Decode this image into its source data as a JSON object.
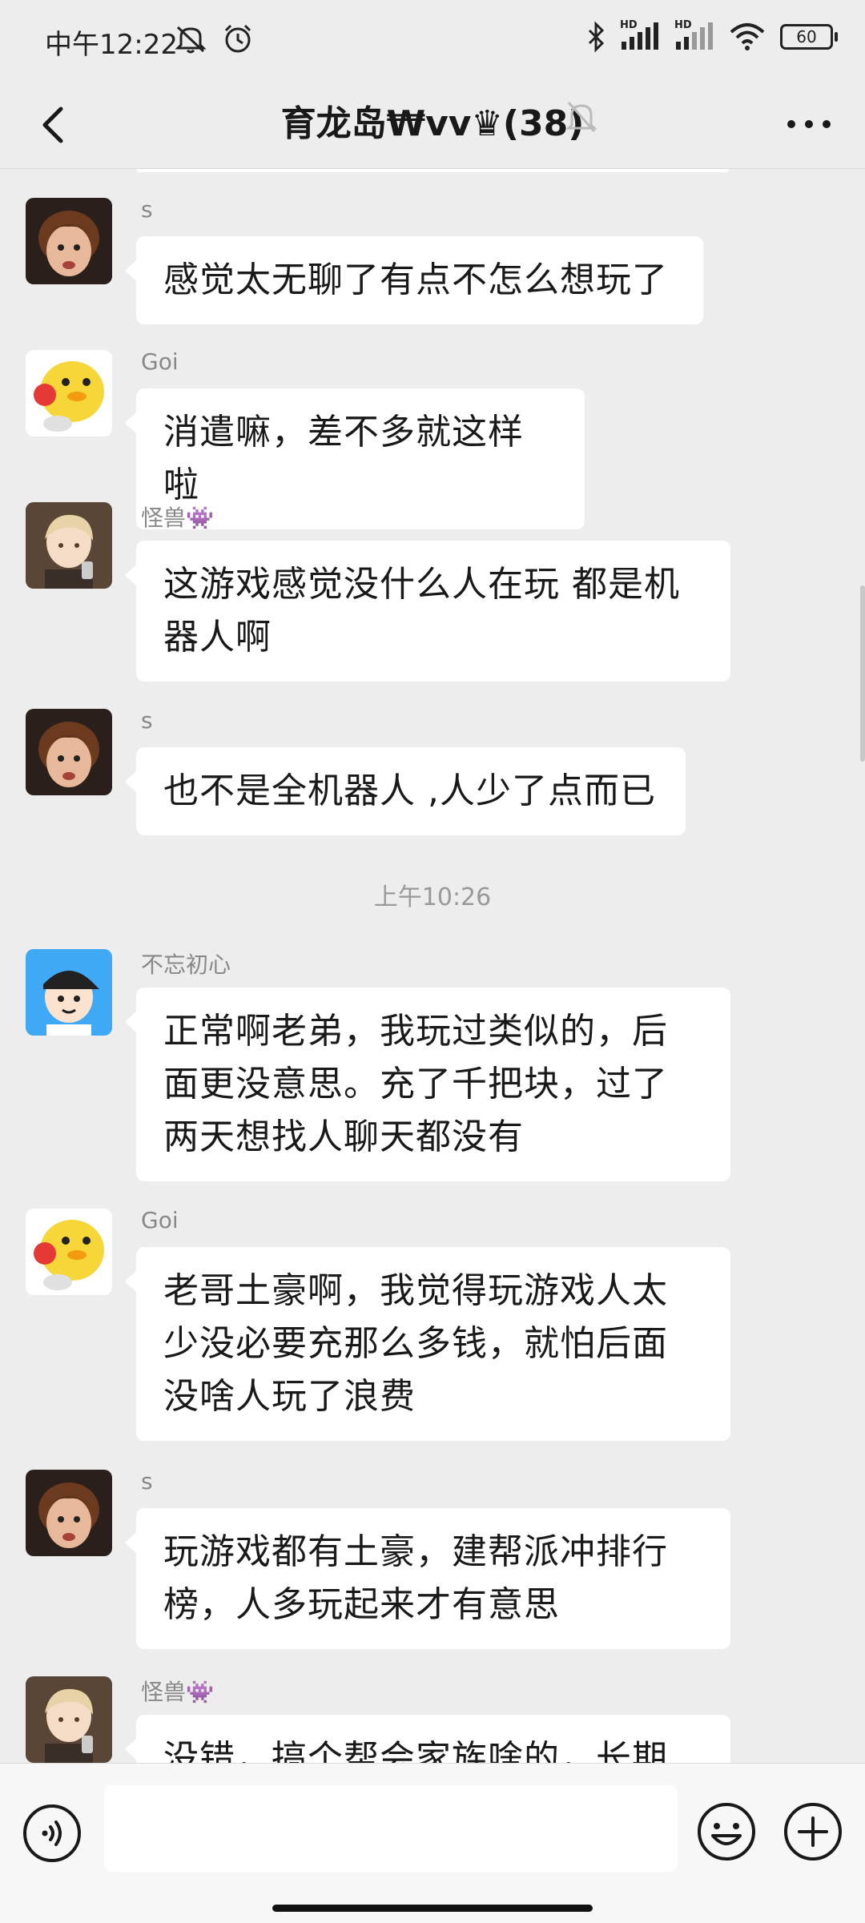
{
  "status_bar": {
    "time": "中午12:22",
    "battery": "60",
    "left_icons": [
      "alarm-off-icon",
      "alarm-clock-icon"
    ],
    "right_icons": [
      "bluetooth-icon",
      "signal-hd-icon",
      "signal-hd-icon",
      "wifi-icon",
      "battery-icon"
    ],
    "hd_label": "HD"
  },
  "header": {
    "title": "育龙岛₩vv♛(38)",
    "icons": [
      "back-icon",
      "mute-icon",
      "more-icon"
    ]
  },
  "messages": [
    {
      "sender": "s",
      "avatar": "child-photo-avatar",
      "text": "感觉太无聊了有点不怎么想玩了"
    },
    {
      "sender": "Goi",
      "avatar": "yellow-duck-avatar",
      "text": "消遣嘛，差不多就这样啦"
    },
    {
      "sender": "怪兽👾",
      "avatar": "anime-boy-avatar",
      "text": "这游戏感觉没什么人在玩 都是机器人啊"
    },
    {
      "sender": "s",
      "avatar": "child-photo-avatar",
      "text": "也不是全机器人 ,人少了点而已"
    },
    {
      "sender": "不忘初心",
      "avatar": "cartoon-boy-cap-avatar",
      "text": "正常啊老弟，我玩过类似的，后面更没意思。充了千把块，过了两天想找人聊天都没有"
    },
    {
      "sender": "Goi",
      "avatar": "yellow-duck-avatar",
      "text": "老哥土豪啊，我觉得玩游戏人太少没必要充那么多钱，就怕后面没啥人玩了浪费"
    },
    {
      "sender": "s",
      "avatar": "child-photo-avatar",
      "text": "玩游戏都有土豪，建帮派冲排行榜，人多玩起来才有意思"
    },
    {
      "sender": "怪兽👾",
      "avatar": "anime-boy-avatar",
      "text": "没错，搞个帮会家族啥的，长期玩"
    }
  ],
  "time_separator": "上午10:26",
  "input_bar": {
    "icons": [
      "voice-icon",
      "emoji-icon",
      "plus-icon"
    ],
    "placeholder": ""
  },
  "colors": {
    "background": "#EDEDED",
    "bubble": "#FFFFFF",
    "sender_name": "#888888",
    "timestamp": "#999999"
  }
}
